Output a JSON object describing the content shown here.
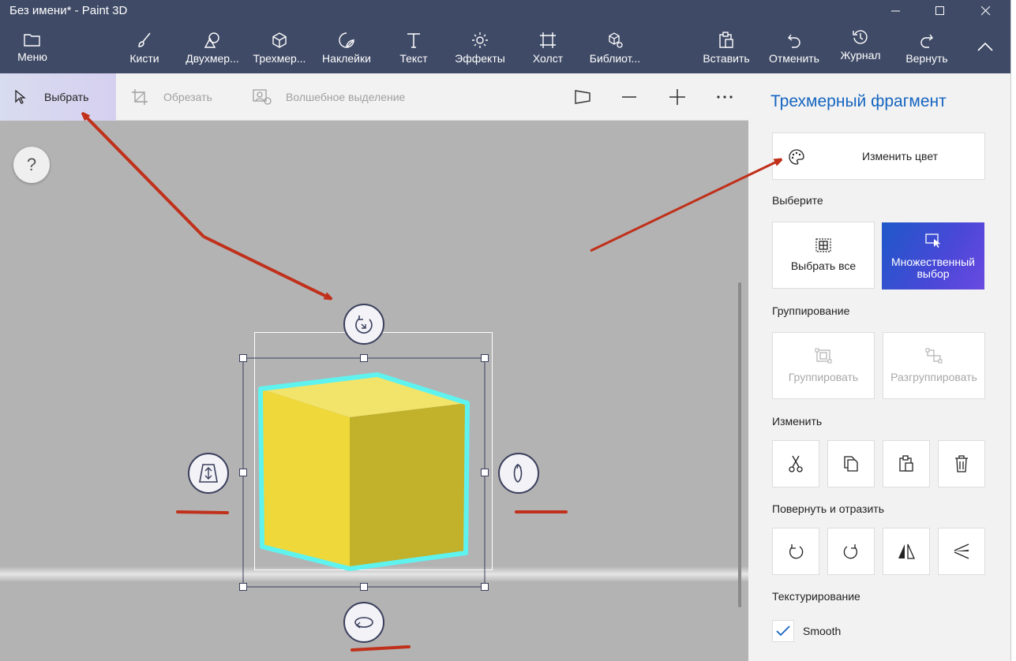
{
  "window": {
    "title": "Без имени* - Paint 3D",
    "minimize_icon": "minimize-icon",
    "maximize_icon": "maximize-icon",
    "close_icon": "close-icon"
  },
  "toolbar": {
    "menu": "Меню",
    "brushes": "Кисти",
    "shapes2d": "Двухмер...",
    "shapes3d": "Трехмер...",
    "stickers": "Наклейки",
    "text": "Текст",
    "effects": "Эффекты",
    "canvas": "Холст",
    "library": "Библиот...",
    "paste": "Вставить",
    "undo": "Отменить",
    "history": "Журнал",
    "redo": "Вернуть"
  },
  "subbar": {
    "select": "Выбрать",
    "crop": "Обрезать",
    "magic_select": "Волшебное выделение"
  },
  "canvas": {
    "help": "?"
  },
  "panel": {
    "title": "Трехмерный фрагмент",
    "change_color": "Изменить цвет",
    "select_label": "Выберите",
    "select_all": "Выбрать все",
    "multi_select": "Множественный выбор",
    "grouping_label": "Группирование",
    "group": "Группировать",
    "ungroup": "Разгруппировать",
    "edit_label": "Изменить",
    "rotate_label": "Повернуть и отразить",
    "texture_label": "Текстурирование",
    "smooth": "Smooth",
    "smooth_checked": true
  },
  "colors": {
    "titlebar": "#3f4a66",
    "accent": "#1565c0",
    "cube_top": "#f2e36a",
    "cube_left": "#eed83a",
    "cube_right": "#c2b12b",
    "cube_outline": "#5ff3f0",
    "annotation": "#c0301a"
  }
}
